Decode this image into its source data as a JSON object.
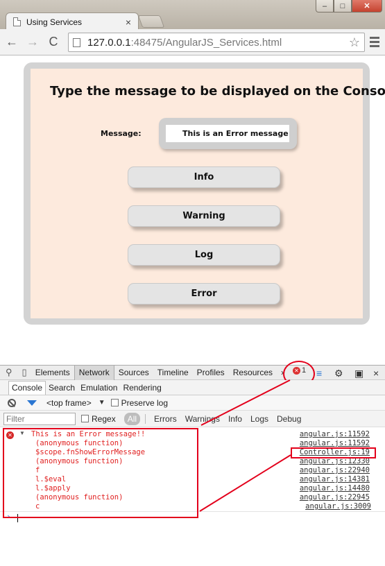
{
  "browser": {
    "tab_title": "Using Services",
    "tab_close": "×",
    "url_host": "127.0.0.1",
    "url_rest": ":48475/AngularJS_Services.html",
    "star": "☆",
    "back": "←",
    "forward": "→",
    "reload": "C"
  },
  "window_buttons": {
    "minimize": "–",
    "maximize": "□",
    "close": "✕"
  },
  "page": {
    "heading": "Type the message to be displayed on the Console:",
    "message_label": "Message:",
    "message_value": "This is an Error message!",
    "buttons": [
      "Info",
      "Warning",
      "Log",
      "Error"
    ]
  },
  "devtools": {
    "tabs": [
      "Elements",
      "Network",
      "Sources",
      "Timeline",
      "Profiles",
      "Resources"
    ],
    "active_tab": "Network",
    "more": "›",
    "error_count": "1",
    "close": "×",
    "drawer_tabs": [
      "Console",
      "Search",
      "Emulation",
      "Rendering"
    ],
    "frame": "<top frame>",
    "preserve_log": "Preserve log",
    "filter_placeholder": "Filter",
    "regex": "Regex",
    "levels": [
      "All",
      "Errors",
      "Warnings",
      "Info",
      "Logs",
      "Debug"
    ],
    "console_lines": [
      {
        "text": "This is an Error message!!",
        "source": "angular.js:11592"
      },
      {
        "text": "(anonymous function)",
        "source": "angular.js:11592"
      },
      {
        "text": "$scope.fnShowErrorMessage",
        "source": "Controller.js:19"
      },
      {
        "text": "(anonymous function)",
        "source": "angular.js:12330"
      },
      {
        "text": "f",
        "source": "angular.js:22940"
      },
      {
        "text": "l.$eval",
        "source": "angular.js:14381"
      },
      {
        "text": "l.$apply",
        "source": "angular.js:14480"
      },
      {
        "text": "(anonymous function)",
        "source": "angular.js:22945"
      },
      {
        "text": "c",
        "source": "angular.js:3009"
      }
    ],
    "prompt": "›"
  },
  "colors": {
    "error_red": "#e02020",
    "panel_bg": "#fdeadd",
    "annotation_red": "#e3001b"
  }
}
